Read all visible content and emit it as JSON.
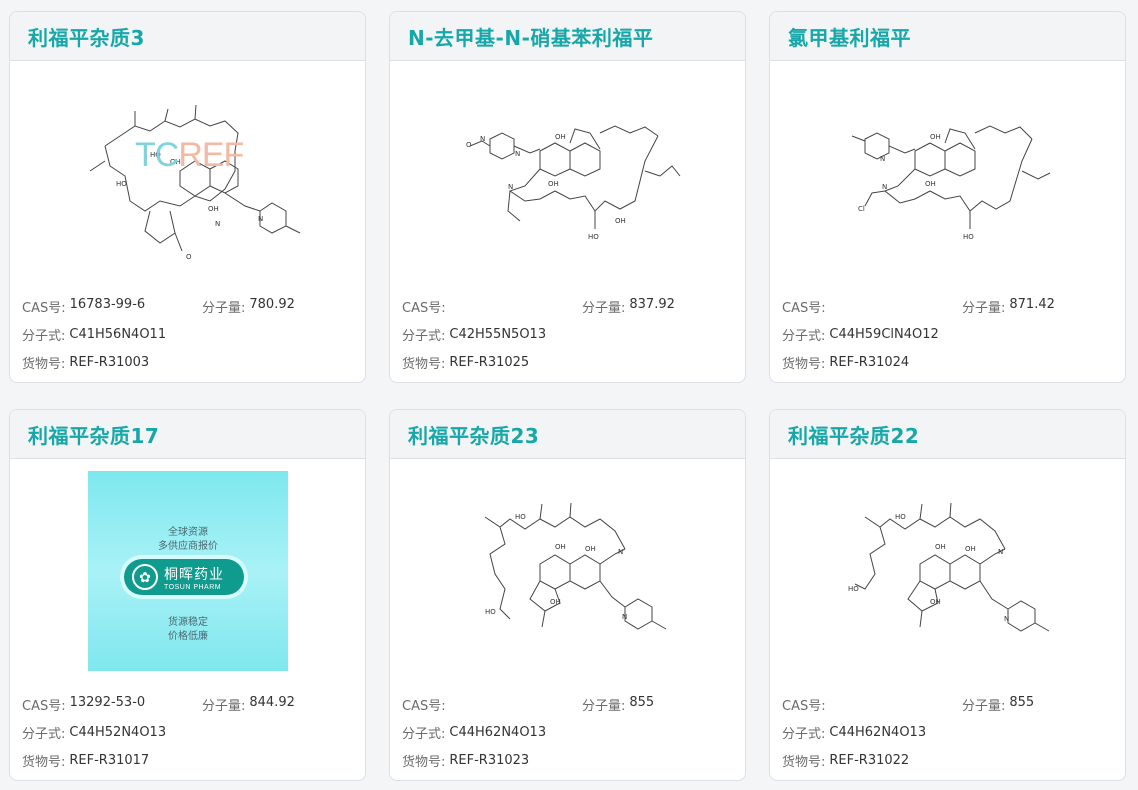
{
  "labels": {
    "cas": "CAS号:",
    "mw": "分子量:",
    "formula": "分子式:",
    "ref": "货物号:"
  },
  "cards": [
    {
      "title": "利福平杂质3",
      "cas": "16783-99-6",
      "mw": "780.92",
      "formula": "C41H56N4O11",
      "ref": "REF-R31003",
      "watermark": {
        "tc": "TC",
        "ref": "REF"
      }
    },
    {
      "title": "N-去甲基-N-硝基苯利福平",
      "cas": "",
      "mw": "837.92",
      "formula": "C42H55N5O13",
      "ref": "REF-R31025"
    },
    {
      "title": "氯甲基利福平",
      "cas": "",
      "mw": "871.42",
      "formula": "C44H59ClN4O12",
      "ref": "REF-R31024"
    },
    {
      "title": "利福平杂质17",
      "cas": "13292-53-0",
      "mw": "844.92",
      "formula": "C44H52N4O13",
      "ref": "REF-R31017",
      "ad": {
        "line1": "全球资源",
        "line2": "多供应商报价",
        "brand_cn": "桐晖药业",
        "brand_en": "TOSUN PHARM",
        "line3": "货源稳定",
        "line4": "价格低廉"
      }
    },
    {
      "title": "利福平杂质23",
      "cas": "",
      "mw": "855",
      "formula": "C44H62N4O13",
      "ref": "REF-R31023"
    },
    {
      "title": "利福平杂质22",
      "cas": "",
      "mw": "855",
      "formula": "C44H62N4O13",
      "ref": "REF-R31022"
    }
  ],
  "colors": {
    "title": "#16a7a9",
    "watermark_tc": "#7fd3dc",
    "watermark_ref": "#f2b9a4"
  }
}
